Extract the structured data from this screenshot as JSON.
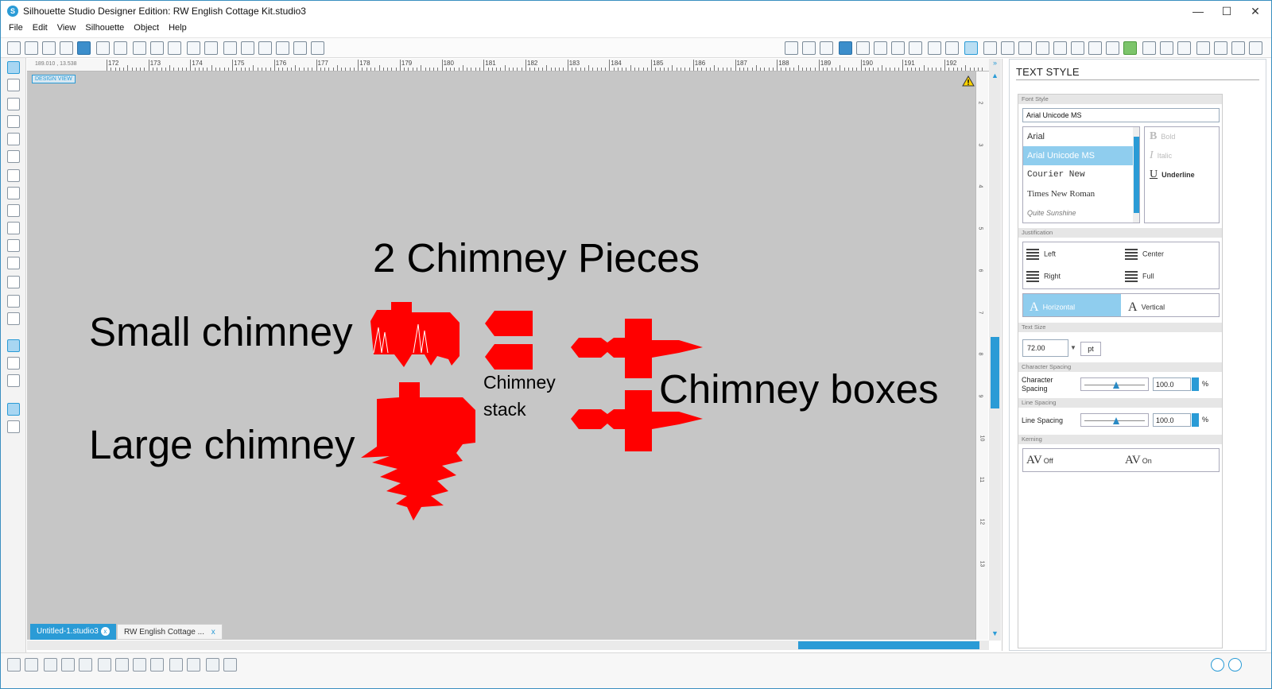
{
  "window": {
    "title": "Silhouette Studio Designer Edition: RW English Cottage Kit.studio3",
    "controls": {
      "minimize": "—",
      "maximize": "☐",
      "close": "✕"
    }
  },
  "menu": [
    "File",
    "Edit",
    "View",
    "Silhouette",
    "Object",
    "Help"
  ],
  "ruler": {
    "coords": "189.010 , 13.538",
    "numbers": [
      "172",
      "173",
      "174",
      "175",
      "176",
      "177",
      "178",
      "179",
      "180",
      "181",
      "182",
      "183",
      "184",
      "185",
      "186",
      "187",
      "188",
      "189",
      "190",
      "191",
      "192"
    ],
    "vertical_numbers": [
      "2",
      "3",
      "4",
      "5",
      "6",
      "7",
      "8",
      "9",
      "10",
      "11",
      "12",
      "13"
    ]
  },
  "canvas": {
    "design_view_label": "DESIGN VIEW",
    "heading": "2 Chimney Pieces",
    "label_small": "Small chimney",
    "label_large": "Large chimney",
    "label_stack_1": "Chimney",
    "label_stack_2": "stack",
    "label_boxes": "Chimney boxes",
    "shape_color": "#ff0000",
    "background_color": "#c6c6c6"
  },
  "doc_tabs": [
    {
      "label": "Untitled-1.studio3",
      "close": "x",
      "active": true
    },
    {
      "label": "RW English Cottage ...",
      "close": "x",
      "active": false
    }
  ],
  "panel": {
    "title": "TEXT STYLE",
    "font_style_header": "Font Style",
    "font_value": "Arial Unicode MS",
    "fonts": [
      "Arial",
      "Arial Unicode MS",
      "Courier New",
      "Times New Roman",
      "Quite Sunshine"
    ],
    "selected_font_index": 1,
    "styles": {
      "bold": "Bold",
      "italic": "Italic",
      "underline": "Underline"
    },
    "justification_header": "Justification",
    "justification": {
      "left": "Left",
      "center": "Center",
      "right": "Right",
      "full": "Full"
    },
    "orientation": {
      "horizontal": "Horizontal",
      "vertical": "Vertical"
    },
    "text_size_header": "Text Size",
    "text_size": "72.00",
    "text_size_unit": "pt",
    "char_spacing_header": "Character Spacing",
    "char_spacing_label_1": "Character",
    "char_spacing_label_2": "Spacing",
    "char_spacing_value": "100.0",
    "line_spacing_header": "Line Spacing",
    "line_spacing_label": "Line Spacing",
    "line_spacing_value": "100.0",
    "percent": "%",
    "kerning_header": "Kerning",
    "kerning": {
      "off": "Off",
      "on": "On",
      "glyph": "AV"
    }
  },
  "colors": {
    "accent": "#2a9bd6",
    "selection": "#8fcdee"
  }
}
